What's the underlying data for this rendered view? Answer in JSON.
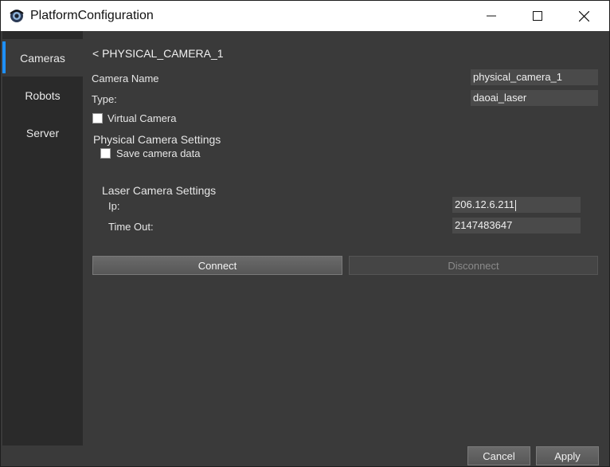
{
  "window": {
    "title": "PlatformConfiguration"
  },
  "sidebar": {
    "items": [
      {
        "label": "Cameras"
      },
      {
        "label": "Robots"
      },
      {
        "label": "Server"
      }
    ]
  },
  "main": {
    "back_label": "< PHYSICAL_CAMERA_1",
    "camera_name_label": "Camera Name",
    "camera_name_value": "physical_camera_1",
    "type_label": "Type:",
    "type_value": "daoai_laser",
    "virtual_camera_label": "Virtual Camera",
    "virtual_camera_checked": false,
    "physical_settings_heading": "Physical Camera Settings",
    "save_camera_data_label": "Save camera data",
    "save_camera_data_checked": false,
    "laser_settings_heading": "Laser Camera Settings",
    "ip_label": "Ip:",
    "ip_value": "206.12.6.211",
    "timeout_label": "Time Out:",
    "timeout_value": "2147483647",
    "connect_label": "Connect",
    "disconnect_label": "Disconnect"
  },
  "footer": {
    "cancel_label": "Cancel",
    "apply_label": "Apply"
  },
  "colors": {
    "accent": "#1e90ff",
    "background": "#3a3a3a",
    "sidebar": "#2a2a2a",
    "field": "#4a4a4a"
  }
}
